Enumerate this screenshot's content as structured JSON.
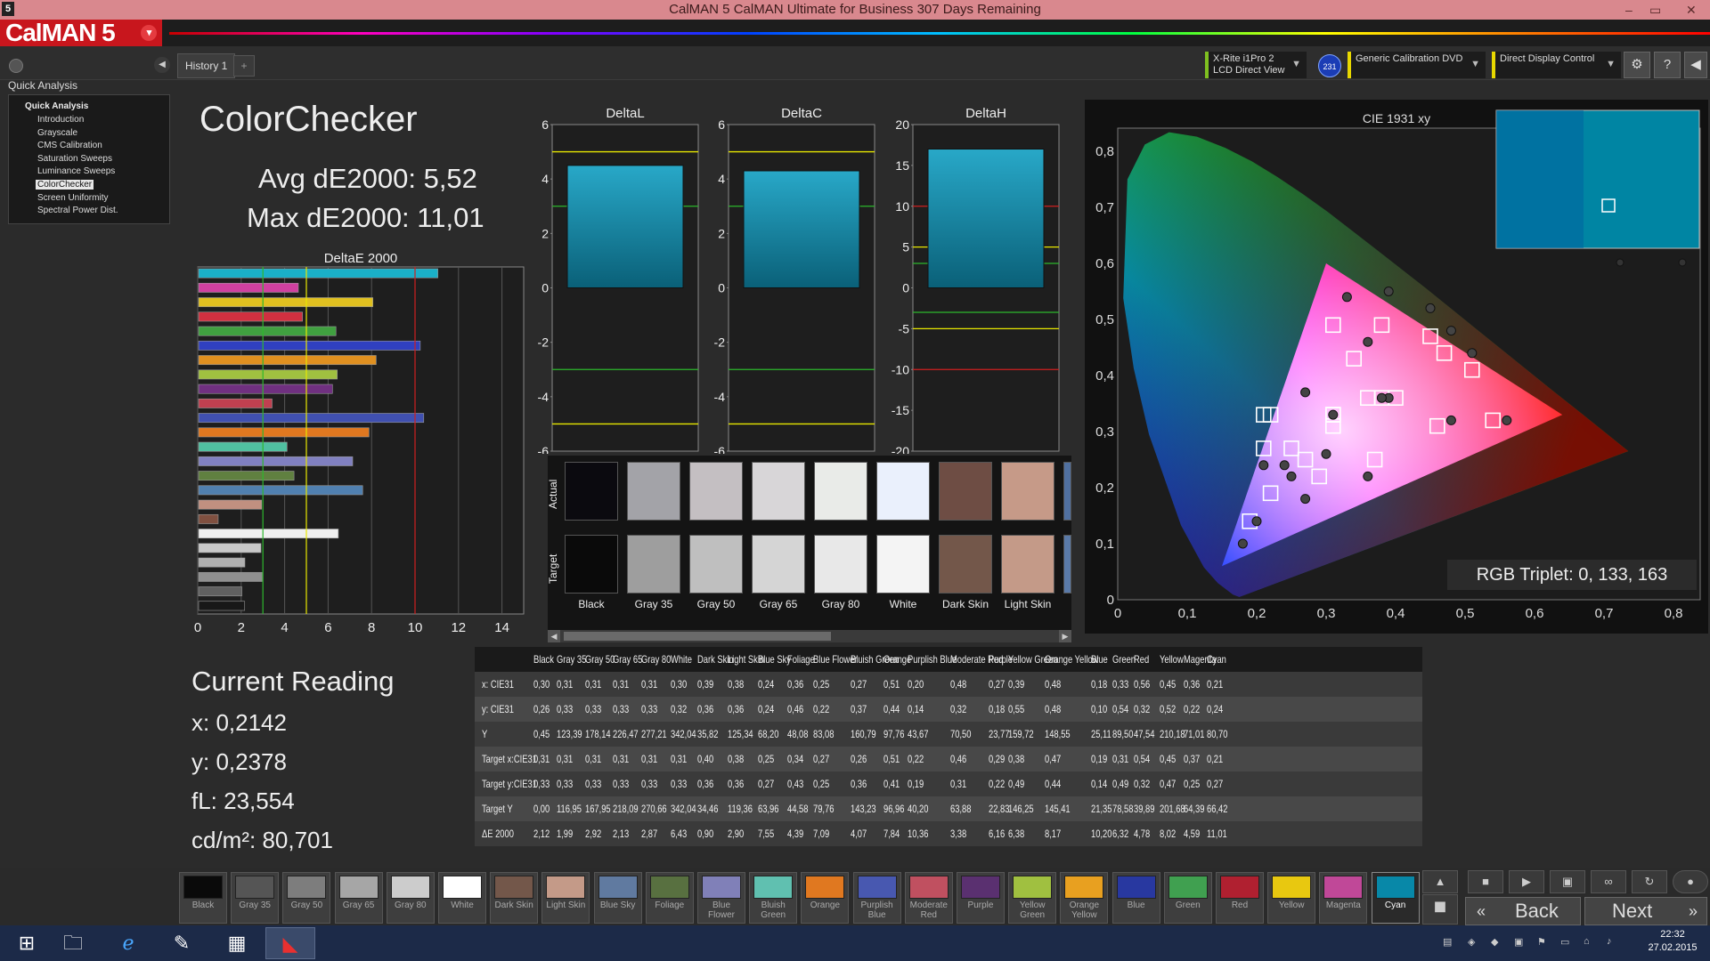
{
  "window": {
    "title": "CalMAN 5 CalMAN Ultimate for Business 307 Days Remaining",
    "app_icon": "5",
    "minimize": "–",
    "maximize": "▭",
    "close": "✕"
  },
  "logo": {
    "text": "CalMAN 5",
    "menu": "▾"
  },
  "history_tab": {
    "label": "History 1",
    "add": "+"
  },
  "devices": [
    {
      "line1": "X-Rite i1Pro 2",
      "line2": "LCD Direct View",
      "accent": "#7fc020"
    },
    {
      "line1": "Generic Calibration DVD",
      "line2": "",
      "accent": "#e8d800"
    },
    {
      "line1": "Direct Display Control",
      "line2": "",
      "accent": "#e8d800"
    }
  ],
  "sensor_badge": "231",
  "sidebar": {
    "title": "Quick Analysis",
    "head": "Quick Analysis",
    "items": [
      "Introduction",
      "Grayscale",
      "CMS Calibration",
      "Saturation Sweeps",
      "Luminance Sweeps",
      "ColorChecker",
      "Screen Uniformity",
      "Spectral Power Dist."
    ],
    "selected": "ColorChecker"
  },
  "main": {
    "title": "ColorChecker",
    "avg": "Avg dE2000: 5,52",
    "max": "Max dE2000: 11,01"
  },
  "delta_e_chart": {
    "title": "DeltaE 2000",
    "xticks": [
      "0",
      "2",
      "4",
      "6",
      "8",
      "10",
      "12",
      "14"
    ],
    "xmax": 15,
    "thresholds": [
      {
        "value": 3,
        "color": "#2db82d"
      },
      {
        "value": 5,
        "color": "#e8e800"
      },
      {
        "value": 10,
        "color": "#d02020"
      }
    ],
    "bars": [
      {
        "value": 11.01,
        "color": "#1ab0c8"
      },
      {
        "value": 4.59,
        "color": "#d040a0"
      },
      {
        "value": 8.02,
        "color": "#e0c020"
      },
      {
        "value": 4.78,
        "color": "#d03040"
      },
      {
        "value": 6.32,
        "color": "#40a040"
      },
      {
        "value": 10.2,
        "color": "#3040c0"
      },
      {
        "value": 8.17,
        "color": "#e09020"
      },
      {
        "value": 6.38,
        "color": "#a0c040"
      },
      {
        "value": 6.16,
        "color": "#703080"
      },
      {
        "value": 3.38,
        "color": "#c04050"
      },
      {
        "value": 10.36,
        "color": "#4050b0"
      },
      {
        "value": 7.84,
        "color": "#e07820"
      },
      {
        "value": 4.07,
        "color": "#50c0a0"
      },
      {
        "value": 7.09,
        "color": "#8080c0"
      },
      {
        "value": 4.39,
        "color": "#608040"
      },
      {
        "value": 7.55,
        "color": "#5080b0"
      },
      {
        "value": 2.9,
        "color": "#c09080"
      },
      {
        "value": 0.9,
        "color": "#805040"
      },
      {
        "value": 6.43,
        "color": "#f0f0f0"
      },
      {
        "value": 2.87,
        "color": "#c8c8c8"
      },
      {
        "value": 2.13,
        "color": "#b0b0b0"
      },
      {
        "value": 2.92,
        "color": "#909090"
      },
      {
        "value": 1.99,
        "color": "#606060"
      },
      {
        "value": 2.12,
        "color": "#181818"
      }
    ]
  },
  "delta_charts": [
    {
      "title": "DeltaL",
      "ticks": [
        "6",
        "4",
        "2",
        "0",
        "-2",
        "-4",
        "-6"
      ],
      "min": -6,
      "max": 6,
      "bar_top": 4.5,
      "bar_bottom": 0,
      "lines": [
        {
          "v": 5,
          "c": "#e8e800"
        },
        {
          "v": 3,
          "c": "#2db82d"
        },
        {
          "v": -3,
          "c": "#2db82d"
        },
        {
          "v": -5,
          "c": "#e8e800"
        }
      ]
    },
    {
      "title": "DeltaC",
      "ticks": [
        "6",
        "4",
        "2",
        "0",
        "-2",
        "-4",
        "-6"
      ],
      "min": -6,
      "max": 6,
      "bar_top": 4.3,
      "bar_bottom": 0,
      "lines": [
        {
          "v": 5,
          "c": "#e8e800"
        },
        {
          "v": 3,
          "c": "#2db82d"
        },
        {
          "v": -3,
          "c": "#2db82d"
        },
        {
          "v": -5,
          "c": "#e8e800"
        }
      ]
    },
    {
      "title": "DeltaH",
      "ticks": [
        "20",
        "15",
        "10",
        "5",
        "0",
        "-5",
        "-10",
        "-15",
        "-20"
      ],
      "min": -20,
      "max": 20,
      "bar_top": 17,
      "bar_bottom": 0,
      "lines": [
        {
          "v": 10,
          "c": "#d02020"
        },
        {
          "v": 5,
          "c": "#e8e800"
        },
        {
          "v": 3,
          "c": "#2db82d"
        },
        {
          "v": -3,
          "c": "#2db82d"
        },
        {
          "v": -5,
          "c": "#e8e800"
        },
        {
          "v": -10,
          "c": "#d02020"
        }
      ]
    }
  ],
  "swatches": {
    "row_actual": "Actual",
    "row_target": "Target",
    "items": [
      {
        "name": "Black",
        "actual": "#0b0a0f",
        "target": "#0a0a0a"
      },
      {
        "name": "Gray 35",
        "actual": "#a3a3a8",
        "target": "#9e9e9e"
      },
      {
        "name": "Gray 50",
        "actual": "#c4bfc2",
        "target": "#bfbfbf"
      },
      {
        "name": "Gray 65",
        "actual": "#d8d6d8",
        "target": "#d5d5d5"
      },
      {
        "name": "Gray 80",
        "actual": "#e9ebe8",
        "target": "#e8e8e8"
      },
      {
        "name": "White",
        "actual": "#eaf0fc",
        "target": "#f4f4f4"
      },
      {
        "name": "Dark Skin",
        "actual": "#6e4d44",
        "target": "#73574a"
      },
      {
        "name": "Light Skin",
        "actual": "#c69a88",
        "target": "#c49a88"
      }
    ]
  },
  "current_reading": {
    "title": "Current Reading",
    "x": "x: 0,2142",
    "y": "y: 0,2378",
    "fl": "fL: 23,554",
    "cdm2": "cd/m²: 80,701"
  },
  "cie": {
    "title": "CIE 1931 xy",
    "xticks": [
      "0",
      "0,1",
      "0,2",
      "0,3",
      "0,4",
      "0,5",
      "0,6",
      "0,7",
      "0,8"
    ],
    "yticks": [
      "0,8",
      "0,7",
      "0,6",
      "0,5",
      "0,4",
      "0,3",
      "0,2",
      "0,1",
      "0"
    ],
    "rgb_triplet": "RGB Triplet: 0, 133, 163",
    "inset_color": "#0085a3",
    "targets": [
      [
        0.21,
        0.33
      ],
      [
        0.22,
        0.33
      ],
      [
        0.31,
        0.31
      ],
      [
        0.31,
        0.33
      ],
      [
        0.31,
        0.33
      ],
      [
        0.31,
        0.33
      ],
      [
        0.4,
        0.36
      ],
      [
        0.38,
        0.36
      ],
      [
        0.25,
        0.27
      ],
      [
        0.34,
        0.43
      ],
      [
        0.27,
        0.25
      ],
      [
        0.36,
        0.36
      ],
      [
        0.51,
        0.41
      ],
      [
        0.22,
        0.19
      ],
      [
        0.46,
        0.31
      ],
      [
        0.29,
        0.22
      ],
      [
        0.38,
        0.49
      ],
      [
        0.47,
        0.44
      ],
      [
        0.19,
        0.14
      ],
      [
        0.31,
        0.49
      ],
      [
        0.54,
        0.32
      ],
      [
        0.45,
        0.47
      ],
      [
        0.37,
        0.25
      ],
      [
        0.21,
        0.27
      ]
    ],
    "actuals": [
      [
        0.3,
        0.26
      ],
      [
        0.31,
        0.33
      ],
      [
        0.39,
        0.36
      ],
      [
        0.38,
        0.36
      ],
      [
        0.24,
        0.24
      ],
      [
        0.36,
        0.46
      ],
      [
        0.25,
        0.22
      ],
      [
        0.27,
        0.37
      ],
      [
        0.51,
        0.44
      ],
      [
        0.2,
        0.14
      ],
      [
        0.48,
        0.32
      ],
      [
        0.27,
        0.18
      ],
      [
        0.39,
        0.55
      ],
      [
        0.48,
        0.48
      ],
      [
        0.18,
        0.1
      ],
      [
        0.33,
        0.54
      ],
      [
        0.56,
        0.32
      ],
      [
        0.45,
        0.52
      ],
      [
        0.36,
        0.22
      ],
      [
        0.21,
        0.24
      ]
    ]
  },
  "table": {
    "columns": [
      "Black",
      "Gray 35",
      "Gray 50",
      "Gray 65",
      "Gray 80",
      "White",
      "Dark Skin",
      "Light Skin",
      "Blue Sky",
      "Foliage",
      "Blue Flower",
      "Bluish Green",
      "Orange",
      "Purplish Blue",
      "Moderate Red",
      "Purple",
      "Yellow Green",
      "Orange Yellow",
      "Blue",
      "Green",
      "Red",
      "Yellow",
      "Magenta",
      "Cyan"
    ],
    "rows": [
      {
        "label": "x: CIE31",
        "values": [
          "0,30",
          "0,31",
          "0,31",
          "0,31",
          "0,31",
          "0,30",
          "0,39",
          "0,38",
          "0,24",
          "0,36",
          "0,25",
          "0,27",
          "0,51",
          "0,20",
          "0,48",
          "0,27",
          "0,39",
          "0,48",
          "0,18",
          "0,33",
          "0,56",
          "0,45",
          "0,36",
          "0,21"
        ]
      },
      {
        "label": "y: CIE31",
        "values": [
          "0,26",
          "0,33",
          "0,33",
          "0,33",
          "0,33",
          "0,32",
          "0,36",
          "0,36",
          "0,24",
          "0,46",
          "0,22",
          "0,37",
          "0,44",
          "0,14",
          "0,32",
          "0,18",
          "0,55",
          "0,48",
          "0,10",
          "0,54",
          "0,32",
          "0,52",
          "0,22",
          "0,24"
        ]
      },
      {
        "label": "Y",
        "values": [
          "0,45",
          "123,39",
          "178,14",
          "226,47",
          "277,21",
          "342,04",
          "35,82",
          "125,34",
          "68,20",
          "48,08",
          "83,08",
          "160,79",
          "97,76",
          "43,67",
          "70,50",
          "23,77",
          "159,72",
          "148,55",
          "25,11",
          "89,50",
          "47,54",
          "210,18",
          "71,01",
          "80,70"
        ]
      },
      {
        "label": "Target x:CIE31",
        "values": [
          "0,31",
          "0,31",
          "0,31",
          "0,31",
          "0,31",
          "0,31",
          "0,40",
          "0,38",
          "0,25",
          "0,34",
          "0,27",
          "0,26",
          "0,51",
          "0,22",
          "0,46",
          "0,29",
          "0,38",
          "0,47",
          "0,19",
          "0,31",
          "0,54",
          "0,45",
          "0,37",
          "0,21"
        ]
      },
      {
        "label": "Target y:CIE31",
        "values": [
          "0,33",
          "0,33",
          "0,33",
          "0,33",
          "0,33",
          "0,33",
          "0,36",
          "0,36",
          "0,27",
          "0,43",
          "0,25",
          "0,36",
          "0,41",
          "0,19",
          "0,31",
          "0,22",
          "0,49",
          "0,44",
          "0,14",
          "0,49",
          "0,32",
          "0,47",
          "0,25",
          "0,27"
        ]
      },
      {
        "label": "Target Y",
        "values": [
          "0,00",
          "116,95",
          "167,95",
          "218,09",
          "270,66",
          "342,04",
          "34,46",
          "119,36",
          "63,96",
          "44,58",
          "79,76",
          "143,23",
          "96,96",
          "40,20",
          "63,88",
          "22,83",
          "146,25",
          "145,41",
          "21,35",
          "78,58",
          "39,89",
          "201,68",
          "64,39",
          "66,42"
        ]
      },
      {
        "label": "ΔE 2000",
        "values": [
          "2,12",
          "1,99",
          "2,92",
          "2,13",
          "2,87",
          "6,43",
          "0,90",
          "2,90",
          "7,55",
          "4,39",
          "7,09",
          "4,07",
          "7,84",
          "10,36",
          "3,38",
          "6,16",
          "6,38",
          "8,17",
          "10,20",
          "6,32",
          "4,78",
          "8,02",
          "4,59",
          "11,01"
        ]
      }
    ]
  },
  "bottom_swatches": [
    {
      "label": "Black",
      "color": "#0a0a0a"
    },
    {
      "label": "Gray 35",
      "color": "#555555"
    },
    {
      "label": "Gray 50",
      "color": "#7d7d7d"
    },
    {
      "label": "Gray 65",
      "color": "#a6a6a6"
    },
    {
      "label": "Gray 80",
      "color": "#cccccc"
    },
    {
      "label": "White",
      "color": "#ffffff"
    },
    {
      "label": "Dark Skin",
      "color": "#73574a"
    },
    {
      "label": "Light Skin",
      "color": "#c49a88"
    },
    {
      "label": "Blue Sky",
      "color": "#607aa0"
    },
    {
      "label": "Foliage",
      "color": "#587040"
    },
    {
      "label": "Blue Flower",
      "color": "#8080b8"
    },
    {
      "label": "Bluish Green",
      "color": "#60c0b0"
    },
    {
      "label": "Orange",
      "color": "#e07820"
    },
    {
      "label": "Purplish Blue",
      "color": "#4858b0"
    },
    {
      "label": "Moderate Red",
      "color": "#c05060"
    },
    {
      "label": "Purple",
      "color": "#5a3070"
    },
    {
      "label": "Yellow Green",
      "color": "#a0c040"
    },
    {
      "label": "Orange Yellow",
      "color": "#e8a020"
    },
    {
      "label": "Blue",
      "color": "#2838a0"
    },
    {
      "label": "Green",
      "color": "#40a050"
    },
    {
      "label": "Red",
      "color": "#b02030"
    },
    {
      "label": "Yellow",
      "color": "#e8c810"
    },
    {
      "label": "Magenta",
      "color": "#c04898"
    },
    {
      "label": "Cyan",
      "color": "#0888a8"
    }
  ],
  "nav": {
    "back": "Back",
    "next": "Next"
  },
  "taskbar": {
    "time": "22:32",
    "date": "27.02.2015"
  }
}
